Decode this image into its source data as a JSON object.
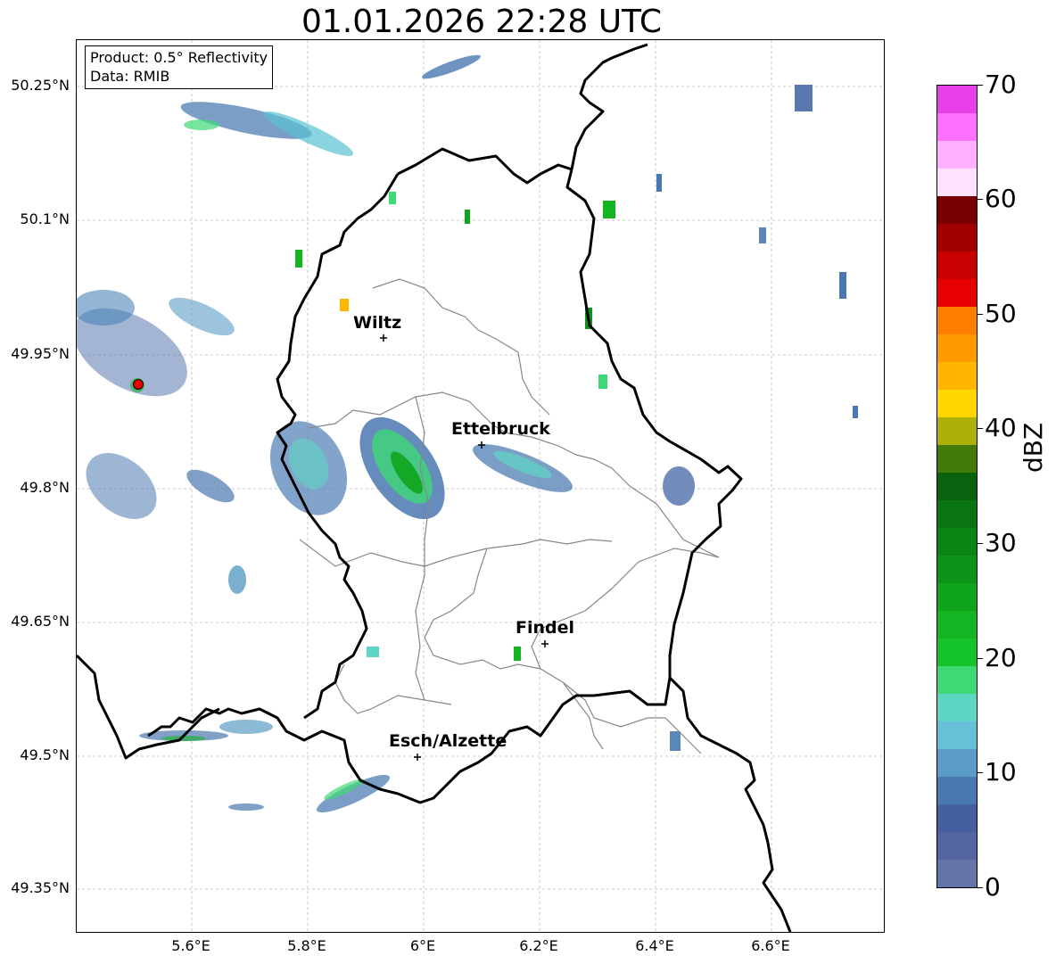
{
  "title": "01.01.2026 22:28 UTC",
  "info": {
    "product": "Product: 0.5° Reflectivity",
    "data": "Data: RMIB"
  },
  "axes": {
    "lat_labels": [
      "50.25°N",
      "50.1°N",
      "49.95°N",
      "49.8°N",
      "49.65°N",
      "49.5°N",
      "49.35°N"
    ],
    "lon_labels": [
      "5.6°E",
      "5.8°E",
      "6°E",
      "6.2°E",
      "6.4°E",
      "6.6°E"
    ]
  },
  "cities": {
    "wiltz": "Wiltz",
    "ettelbruck": "Ettelbruck",
    "findel": "Findel",
    "esch": "Esch/Alzette"
  },
  "colorbar": {
    "label": "dBZ",
    "ticks": [
      "0",
      "10",
      "20",
      "30",
      "40",
      "50",
      "60",
      "70"
    ],
    "colors": [
      "#6474a8",
      "#5466a0",
      "#445e9e",
      "#4a78b0",
      "#5a9cc6",
      "#66c0d8",
      "#5ed6c4",
      "#3ed876",
      "#14c42a",
      "#14b422",
      "#10a41c",
      "#0c9418",
      "#0a8414",
      "#0a7412",
      "#0a620e",
      "#447a0a",
      "#acb008",
      "#ffd600",
      "#ffb600",
      "#ff9a00",
      "#ff7e00",
      "#e60000",
      "#c80000",
      "#a00000",
      "#780000",
      "#ffe0ff",
      "#ffb0ff",
      "#ff70ff",
      "#e840e8"
    ]
  }
}
